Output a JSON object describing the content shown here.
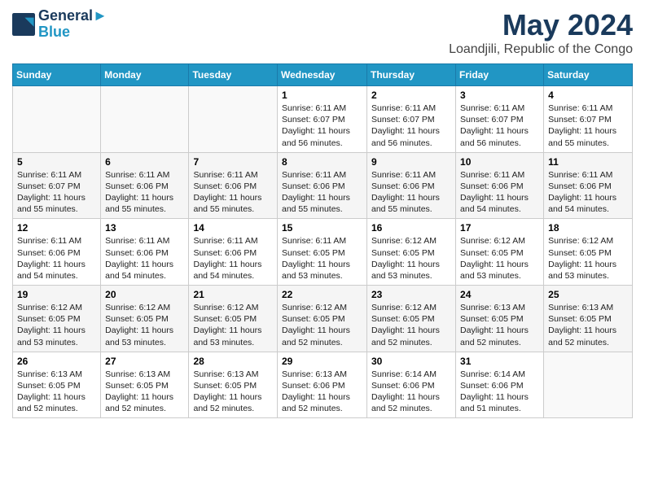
{
  "header": {
    "logo_line1": "General",
    "logo_line2": "Blue",
    "month": "May 2024",
    "location": "Loandjili, Republic of the Congo"
  },
  "weekdays": [
    "Sunday",
    "Monday",
    "Tuesday",
    "Wednesday",
    "Thursday",
    "Friday",
    "Saturday"
  ],
  "weeks": [
    [
      {
        "day": "",
        "info": ""
      },
      {
        "day": "",
        "info": ""
      },
      {
        "day": "",
        "info": ""
      },
      {
        "day": "1",
        "info": "Sunrise: 6:11 AM\nSunset: 6:07 PM\nDaylight: 11 hours and 56 minutes."
      },
      {
        "day": "2",
        "info": "Sunrise: 6:11 AM\nSunset: 6:07 PM\nDaylight: 11 hours and 56 minutes."
      },
      {
        "day": "3",
        "info": "Sunrise: 6:11 AM\nSunset: 6:07 PM\nDaylight: 11 hours and 56 minutes."
      },
      {
        "day": "4",
        "info": "Sunrise: 6:11 AM\nSunset: 6:07 PM\nDaylight: 11 hours and 55 minutes."
      }
    ],
    [
      {
        "day": "5",
        "info": "Sunrise: 6:11 AM\nSunset: 6:07 PM\nDaylight: 11 hours and 55 minutes."
      },
      {
        "day": "6",
        "info": "Sunrise: 6:11 AM\nSunset: 6:06 PM\nDaylight: 11 hours and 55 minutes."
      },
      {
        "day": "7",
        "info": "Sunrise: 6:11 AM\nSunset: 6:06 PM\nDaylight: 11 hours and 55 minutes."
      },
      {
        "day": "8",
        "info": "Sunrise: 6:11 AM\nSunset: 6:06 PM\nDaylight: 11 hours and 55 minutes."
      },
      {
        "day": "9",
        "info": "Sunrise: 6:11 AM\nSunset: 6:06 PM\nDaylight: 11 hours and 55 minutes."
      },
      {
        "day": "10",
        "info": "Sunrise: 6:11 AM\nSunset: 6:06 PM\nDaylight: 11 hours and 54 minutes."
      },
      {
        "day": "11",
        "info": "Sunrise: 6:11 AM\nSunset: 6:06 PM\nDaylight: 11 hours and 54 minutes."
      }
    ],
    [
      {
        "day": "12",
        "info": "Sunrise: 6:11 AM\nSunset: 6:06 PM\nDaylight: 11 hours and 54 minutes."
      },
      {
        "day": "13",
        "info": "Sunrise: 6:11 AM\nSunset: 6:06 PM\nDaylight: 11 hours and 54 minutes."
      },
      {
        "day": "14",
        "info": "Sunrise: 6:11 AM\nSunset: 6:06 PM\nDaylight: 11 hours and 54 minutes."
      },
      {
        "day": "15",
        "info": "Sunrise: 6:11 AM\nSunset: 6:05 PM\nDaylight: 11 hours and 53 minutes."
      },
      {
        "day": "16",
        "info": "Sunrise: 6:12 AM\nSunset: 6:05 PM\nDaylight: 11 hours and 53 minutes."
      },
      {
        "day": "17",
        "info": "Sunrise: 6:12 AM\nSunset: 6:05 PM\nDaylight: 11 hours and 53 minutes."
      },
      {
        "day": "18",
        "info": "Sunrise: 6:12 AM\nSunset: 6:05 PM\nDaylight: 11 hours and 53 minutes."
      }
    ],
    [
      {
        "day": "19",
        "info": "Sunrise: 6:12 AM\nSunset: 6:05 PM\nDaylight: 11 hours and 53 minutes."
      },
      {
        "day": "20",
        "info": "Sunrise: 6:12 AM\nSunset: 6:05 PM\nDaylight: 11 hours and 53 minutes."
      },
      {
        "day": "21",
        "info": "Sunrise: 6:12 AM\nSunset: 6:05 PM\nDaylight: 11 hours and 53 minutes."
      },
      {
        "day": "22",
        "info": "Sunrise: 6:12 AM\nSunset: 6:05 PM\nDaylight: 11 hours and 52 minutes."
      },
      {
        "day": "23",
        "info": "Sunrise: 6:12 AM\nSunset: 6:05 PM\nDaylight: 11 hours and 52 minutes."
      },
      {
        "day": "24",
        "info": "Sunrise: 6:13 AM\nSunset: 6:05 PM\nDaylight: 11 hours and 52 minutes."
      },
      {
        "day": "25",
        "info": "Sunrise: 6:13 AM\nSunset: 6:05 PM\nDaylight: 11 hours and 52 minutes."
      }
    ],
    [
      {
        "day": "26",
        "info": "Sunrise: 6:13 AM\nSunset: 6:05 PM\nDaylight: 11 hours and 52 minutes."
      },
      {
        "day": "27",
        "info": "Sunrise: 6:13 AM\nSunset: 6:05 PM\nDaylight: 11 hours and 52 minutes."
      },
      {
        "day": "28",
        "info": "Sunrise: 6:13 AM\nSunset: 6:05 PM\nDaylight: 11 hours and 52 minutes."
      },
      {
        "day": "29",
        "info": "Sunrise: 6:13 AM\nSunset: 6:06 PM\nDaylight: 11 hours and 52 minutes."
      },
      {
        "day": "30",
        "info": "Sunrise: 6:14 AM\nSunset: 6:06 PM\nDaylight: 11 hours and 52 minutes."
      },
      {
        "day": "31",
        "info": "Sunrise: 6:14 AM\nSunset: 6:06 PM\nDaylight: 11 hours and 51 minutes."
      },
      {
        "day": "",
        "info": ""
      }
    ]
  ]
}
